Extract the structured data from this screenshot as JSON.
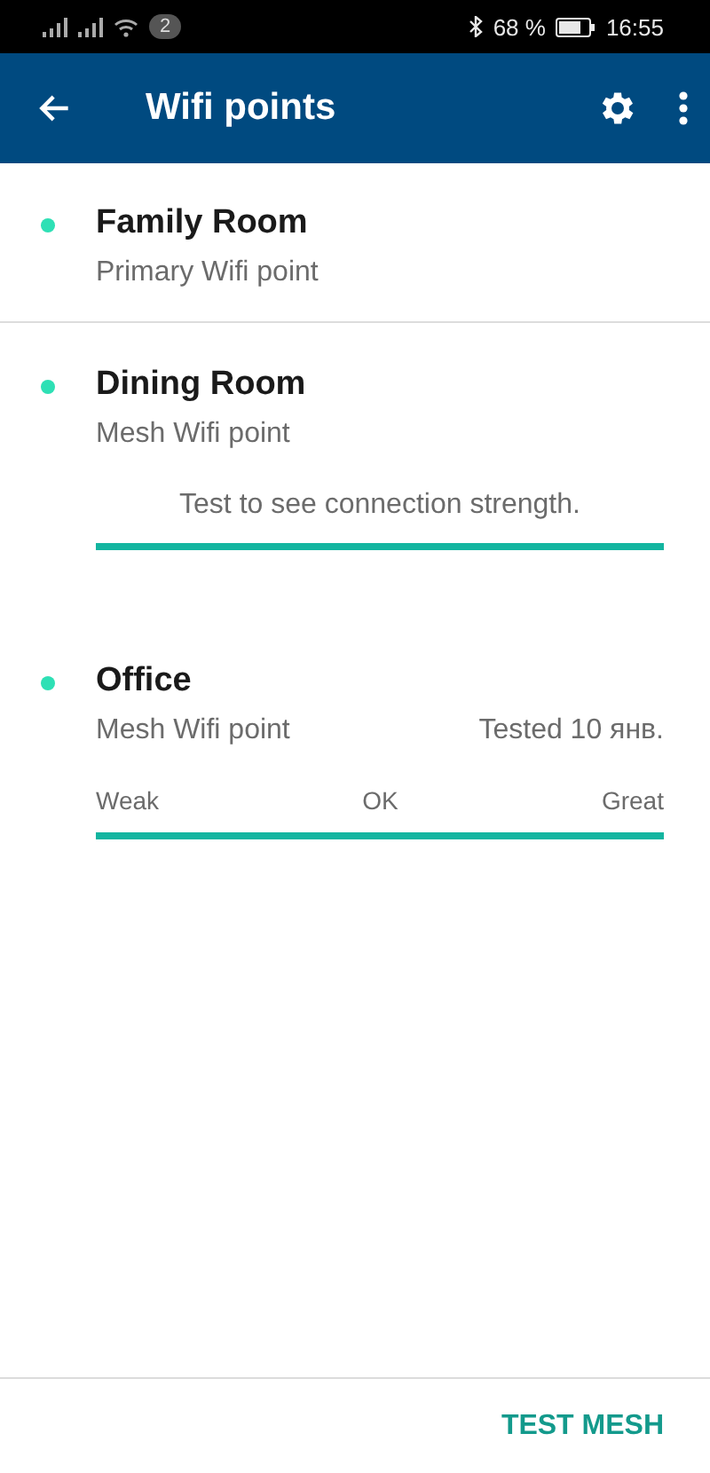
{
  "status_bar": {
    "notification_count": "2",
    "battery": "68 %",
    "time": "16:55"
  },
  "app_bar": {
    "title": "Wifi points"
  },
  "points": [
    {
      "kind": "plain",
      "name": "Family Room",
      "role": "Primary Wifi point"
    },
    {
      "kind": "prompt",
      "name": "Dining Room",
      "role": "Mesh Wifi point",
      "prompt": "Test to see connection strength.",
      "level": 1
    },
    {
      "kind": "tested",
      "name": "Office",
      "role": "Mesh Wifi point",
      "tested": "Tested 10 янв.",
      "scale": [
        "Weak",
        "OK",
        "Great"
      ],
      "level": 1
    }
  ],
  "footer": {
    "action": "TEST MESH"
  }
}
